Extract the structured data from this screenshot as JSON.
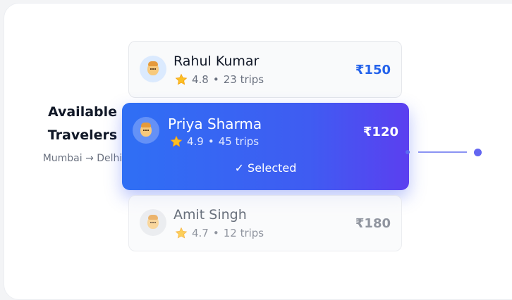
{
  "heading": {
    "title_line1": "Available",
    "title_line2": "Travelers",
    "route": "Mumbai → Delhi"
  },
  "travelers": [
    {
      "name": "Rahul Kumar",
      "rating": "4.8",
      "trips": "23 trips",
      "price": "₹150",
      "state": "default"
    },
    {
      "name": "Priya Sharma",
      "rating": "4.9",
      "trips": "45 trips",
      "price": "₹120",
      "state": "selected",
      "selected_label": "✓ Selected"
    },
    {
      "name": "Amit Singh",
      "rating": "4.7",
      "trips": "12 trips",
      "price": "₹180",
      "state": "dimmed"
    }
  ],
  "separator": "•",
  "colors": {
    "accent": "#2563eb",
    "selected_gradient_start": "#2f6ff4",
    "selected_gradient_end": "#5b3ff0",
    "connector": "#6366f1"
  },
  "icons": {
    "avatar": "person-avatar-icon",
    "rating": "star-icon"
  }
}
